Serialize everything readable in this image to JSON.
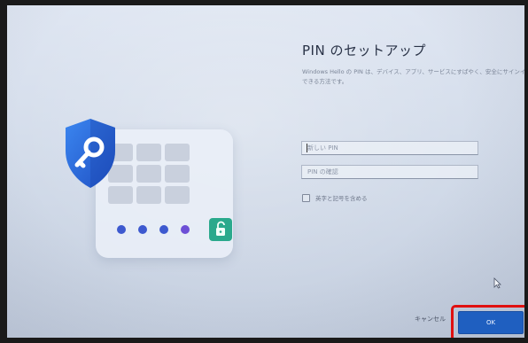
{
  "setup": {
    "title": "PIN のセットアップ",
    "description": "Windows Hello の PIN は、デバイス、アプリ、サービスにすばやく、安全にサインインできる方法です。",
    "new_pin_placeholder": "新しい PIN",
    "confirm_pin_placeholder": "PIN の確認",
    "include_symbols_label": "英字と記号を含める",
    "include_symbols_checked": false,
    "cancel_label": "キャンセル",
    "ok_label": "OK"
  },
  "colors": {
    "accent": "#1f5fc0",
    "highlight": "#e01010",
    "shield": "#2f6fd6",
    "lock": "#2aa98c"
  },
  "icons": [
    "shield-key-icon",
    "unlock-icon",
    "mouse-pointer-icon"
  ]
}
